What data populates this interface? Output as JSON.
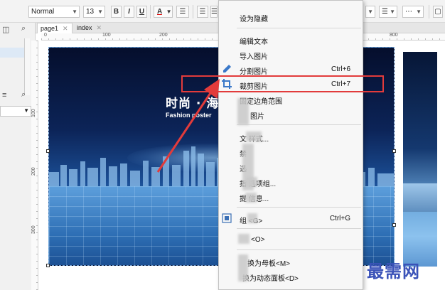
{
  "toolbar": {
    "font_name": "Normal",
    "font_size": "13",
    "bold": "B",
    "italic": "I",
    "underline": "U",
    "font_color": "A"
  },
  "tabs": [
    {
      "label": "page1",
      "close": "✕"
    },
    {
      "label": "index",
      "close": "✕"
    }
  ],
  "ruler": {
    "h_labels": [
      "0",
      "100",
      "200",
      "800"
    ],
    "v_labels": [
      "100",
      "200",
      "300"
    ]
  },
  "poster": {
    "title": "时尚 · 海",
    "subtitle": "Fashion poster"
  },
  "context_menu": {
    "items": [
      {
        "label": "设为隐藏",
        "shortcut": ""
      },
      {
        "label": "编辑文本",
        "shortcut": ""
      },
      {
        "label": "导入图片",
        "shortcut": ""
      },
      {
        "label": "分割图片",
        "shortcut": "Ctrl+6",
        "icon": "split-image-icon"
      },
      {
        "label": "裁剪图片",
        "shortcut": "Ctrl+7",
        "icon": "crop-icon"
      },
      {
        "label": "固定边角范围",
        "shortcut": ""
      },
      {
        "label": "图片",
        "shortcut": ""
      },
      {
        "label": "文 样式...",
        "shortcut": ""
      },
      {
        "label": "禁",
        "shortcut": ""
      },
      {
        "label": "选",
        "shortcut": ""
      },
      {
        "label": "指 选项组...",
        "shortcut": ""
      },
      {
        "label": "提 信息...",
        "shortcut": ""
      },
      {
        "label": "组 <G>",
        "shortcut": "Ctrl+G",
        "icon": "group-icon"
      },
      {
        "label": "<O>",
        "shortcut": ""
      },
      {
        "label": "换为母板<M>",
        "shortcut": ""
      },
      {
        "label": "换为动态面板<D>",
        "shortcut": ""
      }
    ]
  },
  "annotation": {
    "highlight_color": "#e23b3b"
  },
  "watermark": "最需网"
}
